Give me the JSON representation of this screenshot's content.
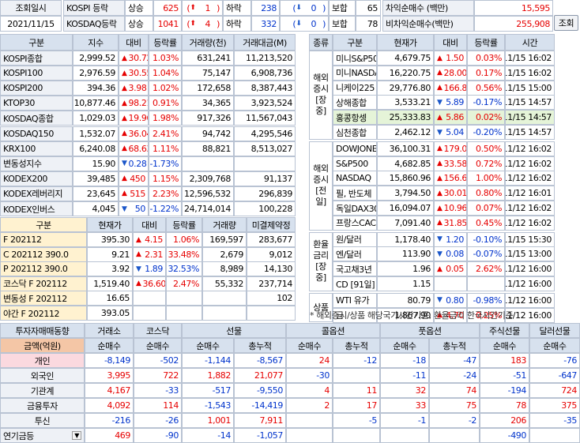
{
  "top": {
    "label_time": "조회일시",
    "date": "2021/11/15",
    "kospi": {
      "name": "KOSPI 등락",
      "up_label": "상승",
      "up": "625",
      "up_limit": "1",
      "down_label": "하락",
      "down": "238",
      "down_limit": "0",
      "flat_label": "보합",
      "flat": "65"
    },
    "kosdaq": {
      "name": "KOSDAQ등락",
      "up_label": "상승",
      "up": "1041",
      "up_limit": "4",
      "down_label": "하락",
      "down": "332",
      "down_limit": "0",
      "flat_label": "보합",
      "flat": "78"
    },
    "arb_label": "차익순매수 (백만)",
    "arb": "15,595",
    "narb_label": "비차익순매수(백만)",
    "narb": "255,908",
    "query_button": "조회"
  },
  "index_table": {
    "headers": [
      "구분",
      "지수",
      "대비",
      "등락률",
      "거래량(천)",
      "거래대금(M)"
    ],
    "rows": [
      [
        "KOSPI종합",
        "2,999.52",
        "up",
        "30.72",
        "1.03%",
        "631,241",
        "11,213,520"
      ],
      [
        "KOSPI100",
        "2,976.59",
        "up",
        "30.55",
        "1.04%",
        "75,147",
        "6,908,736"
      ],
      [
        "KOSPI200",
        "394.36",
        "up",
        "3.98",
        "1.02%",
        "172,658",
        "8,387,443"
      ],
      [
        "KTOP30",
        "10,877.46",
        "up",
        "98.21",
        "0.91%",
        "34,365",
        "3,923,524"
      ],
      [
        "KOSDAQ종합",
        "1,029.03",
        "up",
        "19.96",
        "1.98%",
        "917,326",
        "11,567,043"
      ],
      [
        "KOSDAQ150",
        "1,532.07",
        "up",
        "36.04",
        "2.41%",
        "94,742",
        "4,295,546"
      ],
      [
        "KRX100",
        "6,240.08",
        "up",
        "68.63",
        "1.11%",
        "88,821",
        "8,513,027"
      ],
      [
        "변동성지수",
        "15.90",
        "dn",
        "0.28",
        "-1.73%",
        "",
        ""
      ],
      [
        "KODEX200",
        "39,485",
        "up",
        "450",
        "1.15%",
        "2,309,768",
        "91,137"
      ],
      [
        "KODEX레버리지",
        "23,645",
        "up",
        "515",
        "2.23%",
        "12,596,532",
        "296,839"
      ],
      [
        "KODEX인버스",
        "4,045",
        "dn",
        "50",
        "-1.22%",
        "24,714,014",
        "100,228"
      ]
    ]
  },
  "futures_table": {
    "headers": [
      "구분",
      "현재가",
      "대비",
      "등락률",
      "거래량",
      "미결제약정"
    ],
    "rows": [
      [
        "F 202112",
        "395.30",
        "up",
        "4.15",
        "1.06%",
        "169,597",
        "283,677"
      ],
      [
        "C 202112 390.0",
        "9.21",
        "up",
        "2.31",
        "33.48%",
        "2,679",
        "9,012"
      ],
      [
        "P 202112 390.0",
        "3.92",
        "dn",
        "1.89",
        "32.53%",
        "8,989",
        "14,130"
      ],
      [
        "코스닥 F 202112",
        "1,519.40",
        "up",
        "36.60",
        "2.47%",
        "55,332",
        "237,714"
      ],
      [
        "변동성 F 202112",
        "16.65",
        "",
        "",
        "",
        "",
        "102"
      ],
      [
        "야간 F 202112",
        "393.05",
        "",
        "",
        "",
        "",
        ""
      ]
    ]
  },
  "world_table": {
    "headers": [
      "종류",
      "구분",
      "현재가",
      "대비",
      "등락률",
      "시간"
    ],
    "groups": [
      {
        "category": "해외증시[장중]",
        "rows": [
          [
            "미니S&P500",
            "4,679.75",
            "up",
            "1.50",
            "0.03%",
            "11/15 16:02"
          ],
          [
            "미니NASDAQ",
            "16,220.75",
            "up",
            "28.00",
            "0.17%",
            "11/15 16:02"
          ],
          [
            "니케이225",
            "29,776.80",
            "up",
            "166.83",
            "0.56%",
            "11/15 15:00"
          ],
          [
            "상해종합",
            "3,533.21",
            "dn",
            "5.89",
            "-0.17%",
            "11/15 14:57"
          ],
          [
            "홍콩항셍",
            "25,333.83",
            "up",
            "5.86",
            "0.02%",
            "11/15 14:57"
          ],
          [
            "심천종합",
            "2,462.12",
            "dn",
            "5.04",
            "-0.20%",
            "11/15 14:57"
          ]
        ]
      },
      {
        "category": "해외증시[전일]",
        "rows": [
          [
            "DOWJONES",
            "36,100.31",
            "up",
            "179.08",
            "0.50%",
            "11/12 16:02"
          ],
          [
            "S&P500",
            "4,682.85",
            "up",
            "33.58",
            "0.72%",
            "11/12 16:02"
          ],
          [
            "NASDAQ",
            "15,860.96",
            "up",
            "156.68",
            "1.00%",
            "11/12 16:02"
          ],
          [
            "필, 반도체",
            "3,794.50",
            "up",
            "30.01",
            "0.80%",
            "11/12 16:01"
          ],
          [
            "독일DAX30",
            "16,094.07",
            "up",
            "10.96",
            "0.07%",
            "11/12 16:02"
          ],
          [
            "프랑스CAC40",
            "7,091.40",
            "up",
            "31.85",
            "0.45%",
            "11/12 16:02"
          ]
        ]
      },
      {
        "category": "환율금리[장중]",
        "rows": [
          [
            "원/달러",
            "1,178.40",
            "dn",
            "1.20",
            "-0.10%",
            "11/15 15:30"
          ],
          [
            "엔/달러",
            "113.90",
            "dn",
            "0.08",
            "-0.07%",
            "11/15 13:00"
          ],
          [
            "국고채3년",
            "1.96",
            "up",
            "0.05",
            "2.62%",
            "11/12 16:00"
          ],
          [
            "CD [91일]",
            "1.15",
            "",
            "",
            "",
            "11/12 16:00"
          ]
        ]
      },
      {
        "category": "상품",
        "rows": [
          [
            "WTI 유가",
            "80.79",
            "dn",
            "0.80",
            "-0.98%",
            "11/12 16:00"
          ],
          [
            "금",
            "1,867.90",
            "up",
            "4.70",
            "0.25%",
            "11/12 16:00"
          ]
        ]
      }
    ],
    "note": "* 해외증시/상품 해당국가시간기준, 환율금리 한국시간기준"
  },
  "investor_table": {
    "title": "투자자매매동향",
    "unit": "금액(억원)",
    "col_groups": [
      "거래소",
      "코스닥",
      "선물",
      "콜옵션",
      "풋옵션",
      "주식선물",
      "달러선물"
    ],
    "sub": [
      "순매수",
      "순매수",
      "순매수",
      "총누적",
      "순매수",
      "총누적",
      "순매수",
      "총누적",
      "순매수",
      "순매수"
    ],
    "rows": [
      [
        "개인",
        "-8,149",
        "-502",
        "-1,144",
        "-8,567",
        "24",
        "-12",
        "-18",
        "-47",
        "183",
        "-76"
      ],
      [
        "외국인",
        "3,995",
        "722",
        "1,882",
        "21,077",
        "-30",
        "",
        "-11",
        "-24",
        "-51",
        "-647"
      ],
      [
        "기관계",
        "4,167",
        "-33",
        "-517",
        "-9,550",
        "4",
        "11",
        "32",
        "74",
        "-194",
        "724"
      ],
      [
        "금융투자",
        "4,092",
        "114",
        "-1,543",
        "-14,419",
        "2",
        "17",
        "33",
        "75",
        "78",
        "375"
      ],
      [
        "투신",
        "-216",
        "-26",
        "1,001",
        "7,911",
        "",
        "-5",
        "-1",
        "-2",
        "206",
        "-35"
      ],
      [
        "연기금등",
        "469",
        "-90",
        "-14",
        "-1,057",
        "",
        "",
        "",
        "",
        "-490",
        ""
      ]
    ]
  }
}
